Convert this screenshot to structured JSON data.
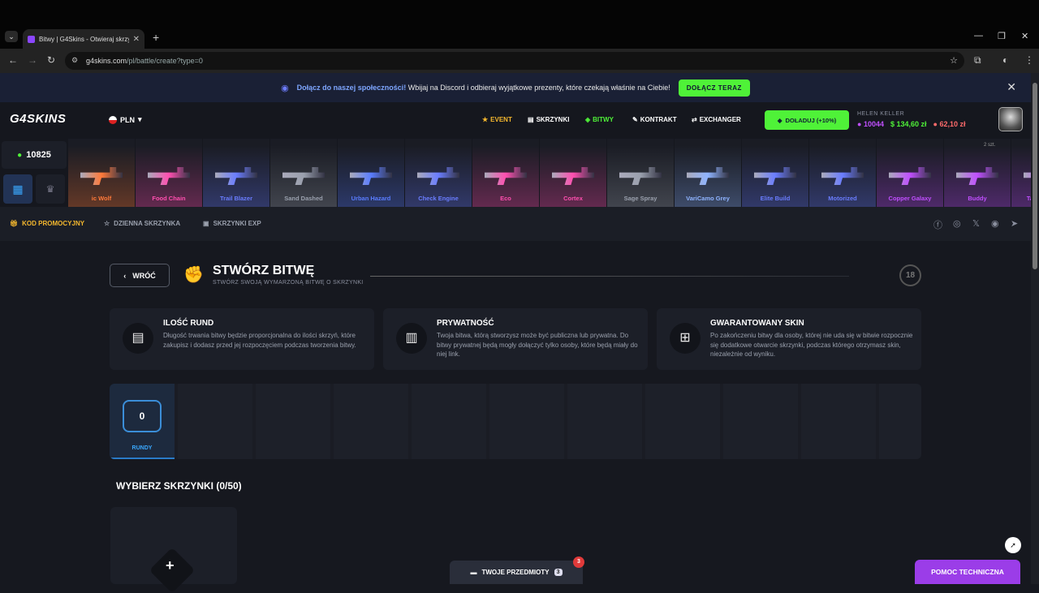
{
  "browser": {
    "tab_title": "Bitwy | G4Skins - Otwieraj skrzy",
    "url_pre": "g4skins.com",
    "url_path": "/pl/battle/create?type=0"
  },
  "promo": {
    "bold": "Dołącz do naszej społeczności!",
    "text": "Wbijaj na Discord i odbieraj wyjątkowe prezenty, które czekają właśnie na Ciebie!",
    "button": "DOŁĄCZ TERAZ"
  },
  "header": {
    "logo": "G4SKINS",
    "currency": "PLN",
    "nav": {
      "event": "EVENT",
      "cases": "SKRZYNKI",
      "battles": "BITWY",
      "contract": "KONTRAKT",
      "exchanger": "EXCHANGER"
    },
    "topup": "DOŁADUJ (+10%)",
    "username": "HELEN KELLER",
    "coins": "10044",
    "balance1": "134,60 zł",
    "balance2": "62,10 zł"
  },
  "ticker": {
    "balance": "10825",
    "corner_label": "2 szt.",
    "drops": [
      {
        "name": "ic Wolf",
        "color": "#ff7a3a"
      },
      {
        "name": "Food Chain",
        "color": "#ff4fb0"
      },
      {
        "name": "Trail Blazer",
        "color": "#6a7dff"
      },
      {
        "name": "Sand Dashed",
        "color": "#9aa0ad"
      },
      {
        "name": "Urban Hazard",
        "color": "#5a7dff"
      },
      {
        "name": "Check Engine",
        "color": "#6a7dff"
      },
      {
        "name": "Eco",
        "color": "#ff4fb0"
      },
      {
        "name": "Cortex",
        "color": "#ff4fb0"
      },
      {
        "name": "Sage Spray",
        "color": "#9aa0ad"
      },
      {
        "name": "VariCamo Grey",
        "color": "#8fb4ff"
      },
      {
        "name": "Elite Build",
        "color": "#6a7dff"
      },
      {
        "name": "Motorized",
        "color": "#6a7dff"
      },
      {
        "name": "Copper Galaxy",
        "color": "#c04fff"
      },
      {
        "name": "Buddy",
        "color": "#c04fff"
      },
      {
        "name": "Taste Buddy",
        "color": "#c04fff"
      }
    ]
  },
  "subnav": {
    "promo_code": "KOD PROMOCYJNY",
    "daily": "DZIENNA SKRZYNKA",
    "exp": "SKRZYNKI EXP"
  },
  "page": {
    "back": "WRÓĆ",
    "title": "STWÓRZ BITWĘ",
    "subtitle": "STWÓRZ SWOJĄ WYMARZONĄ BITWĘ O SKRZYNKI",
    "age": "18"
  },
  "cards": [
    {
      "title": "ILOŚĆ RUND",
      "desc": "Długość trwania bitwy będzie proporcjonalna do ilości skrzyń, które zakupisz i dodasz przed jej rozpoczęciem podczas tworzenia bitwy."
    },
    {
      "title": "PRYWATNOŚĆ",
      "desc": "Twoja bitwa, którą stworzysz może być publiczna lub prywatna. Do bitwy prywatnej będą mogły dołączyć tylko osoby, które będą miały do niej link."
    },
    {
      "title": "GWARANTOWANY SKIN",
      "desc": "Po zakończeniu bitwy dla osoby, której nie uda się w bitwie rozpocznie się dodatkowe otwarcie skrzynki, podczas którego otrzymasz skin, niezależnie od wyniku."
    }
  ],
  "rounds": {
    "value": "0",
    "label": "RUNDY"
  },
  "section_title": "WYBIERZ SKRZYNKI (0/50)",
  "bottom": {
    "items_label": "TWOJE PRZEDMIOTY",
    "items_count": "3",
    "items_badge": "3",
    "help": "POMOC TECHNICZNA"
  }
}
